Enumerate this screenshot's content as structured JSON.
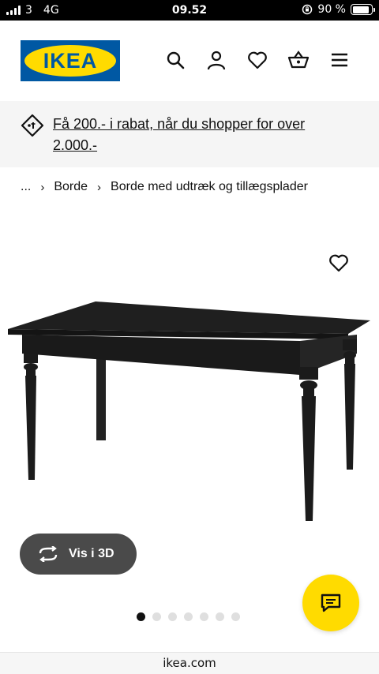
{
  "status_bar": {
    "carrier": "3",
    "network": "4G",
    "time": "09.52",
    "battery_percent": "90 %",
    "battery_level": 0.9
  },
  "header": {
    "logo_text": "IKEA",
    "icons": [
      "search-icon",
      "profile-icon",
      "favourites-icon",
      "cart-icon",
      "menu-icon"
    ]
  },
  "promo": {
    "icon": "discount-tag-icon",
    "text": "Få 200.- i rabat, når du shopper for over 2.000.-"
  },
  "breadcrumb": {
    "ellipsis": "...",
    "items": [
      "Borde",
      "Borde med udtræk og tillægsplader"
    ]
  },
  "product": {
    "image": "black dining table",
    "favourite_icon": "heart-icon"
  },
  "view_3d": {
    "label": "Vis i 3D",
    "icon": "rotate-icon"
  },
  "carousel": {
    "total": 7,
    "active_index": 0
  },
  "chat": {
    "icon": "chat-icon"
  },
  "url_bar": {
    "url": "ikea.com"
  },
  "colors": {
    "ikea_blue": "#0058a3",
    "ikea_yellow": "#ffdb00",
    "promo_bg": "#f5f5f5",
    "button_dark": "#4a4a4a"
  }
}
